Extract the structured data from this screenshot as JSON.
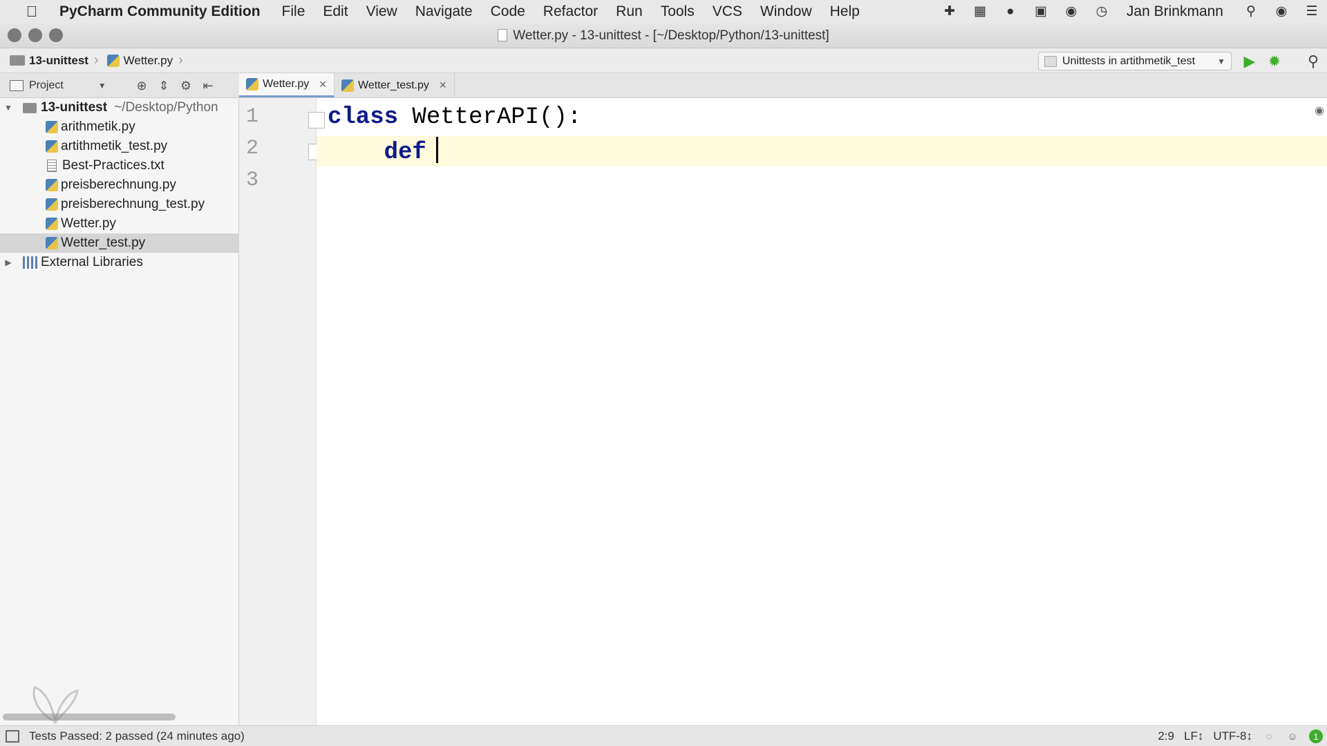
{
  "menubar": {
    "app_name": "PyCharm Community Edition",
    "items": [
      "File",
      "Edit",
      "View",
      "Navigate",
      "Code",
      "Refactor",
      "Run",
      "Tools",
      "VCS",
      "Window",
      "Help"
    ],
    "user": "Jan Brinkmann"
  },
  "window": {
    "title": "Wetter.py - 13-unittest - [~/Desktop/Python/13-unittest]"
  },
  "breadcrumb": {
    "project": "13-unittest",
    "file": "Wetter.py"
  },
  "run_config": {
    "label": "Unittests in artithmetik_test"
  },
  "project_panel": {
    "title": "Project",
    "root_name": "13-unittest",
    "root_path": "~/Desktop/Python",
    "files": [
      {
        "name": "arithmetik.py",
        "type": "python"
      },
      {
        "name": "artithmetik_test.py",
        "type": "python"
      },
      {
        "name": "Best-Practices.txt",
        "type": "text"
      },
      {
        "name": "preisberechnung.py",
        "type": "python"
      },
      {
        "name": "preisberechnung_test.py",
        "type": "python"
      },
      {
        "name": "Wetter.py",
        "type": "python"
      },
      {
        "name": "Wetter_test.py",
        "type": "python",
        "selected": true
      }
    ],
    "external_libraries": "External Libraries"
  },
  "editor_tabs": [
    {
      "label": "Wetter.py",
      "active": true
    },
    {
      "label": "Wetter_test.py",
      "active": false
    }
  ],
  "editor": {
    "line_numbers": [
      "1",
      "2",
      "3"
    ],
    "line1": {
      "keyword": "class",
      "rest": " WetterAPI():"
    },
    "line2": {
      "indent": "    ",
      "keyword": "def"
    }
  },
  "statusbar": {
    "message": "Tests Passed: 2 passed (24 minutes ago)",
    "position": "2:9",
    "line_separator": "LF↕",
    "encoding": "UTF-8↕",
    "notifications": "1"
  },
  "colors": {
    "keyword": "#0d1a8a",
    "current_line": "#fffbdc",
    "run_green": "#3dae2b"
  }
}
